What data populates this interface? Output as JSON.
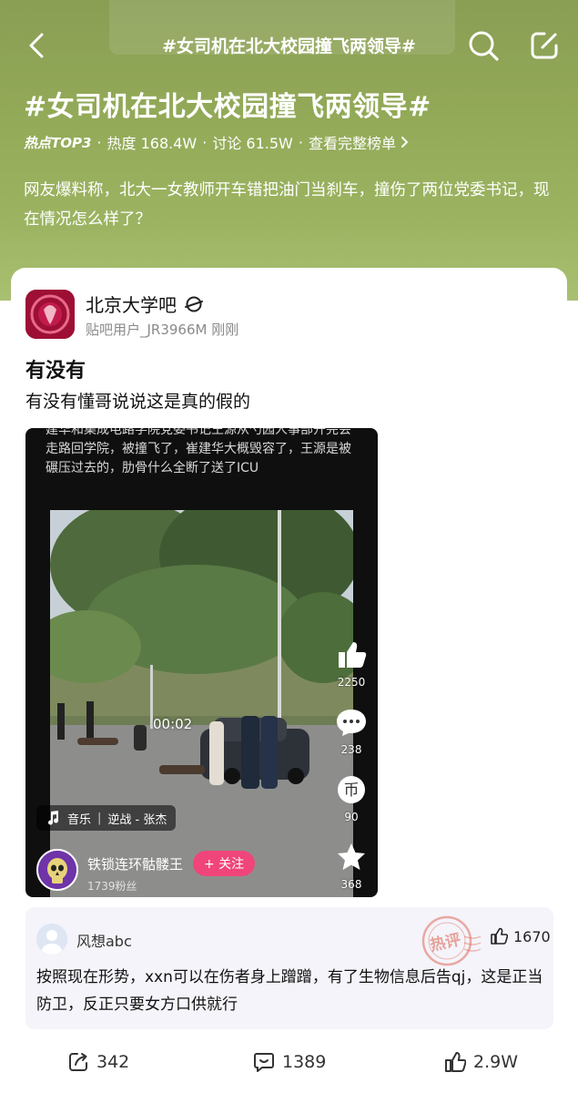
{
  "topbar": {
    "title": "#女司机在北大校园撞飞两领导#"
  },
  "hero": {
    "title": "#女司机在北大校园撞飞两领导#",
    "rank_badge": "热点TOP3",
    "heat": "热度 168.4W",
    "discussion": "讨论 61.5W",
    "full_list_link": "查看完整榜单",
    "description": "网友爆料称，北大一女教师开车错把油门当刹车，撞伤了两位党委书记，现在情况怎么样了？"
  },
  "post": {
    "forum_name": "北京大学吧",
    "author_line": "贴吧用户_JR3966M 刚刚",
    "title": "有没有",
    "body": "有没有懂哥说说这是真的假的"
  },
  "video": {
    "overlay_text": "建华和集成电路学院党委书记王源从勺园人事部开完会走路回学院，被撞飞了，崔建华大概毁容了，王源是被碾压过去的，肋骨什么全断了送了ICU",
    "timecode": "00:02",
    "likes": "2250",
    "comments": "238",
    "coins": "90",
    "favorites": "368",
    "music_label": "音乐",
    "music_track": "逆战 - 张杰",
    "author_name": "铁锁连环骷髅王",
    "follow_label": "+ 关注",
    "author_fans": "1739粉丝"
  },
  "hot_comment": {
    "username": "风想abc",
    "stamp_text": "热评",
    "likes": "1670",
    "text": "按照现在形势，xxn可以在伤者身上蹭蹭，有了生物信息后告qj，这是正当防卫，反正只要女方口供就行"
  },
  "bottom": {
    "shares": "342",
    "comments": "1389",
    "likes": "2.9W"
  },
  "colors": {
    "hero_green": "#93aa58",
    "follow_pink": "#f0457a",
    "comment_bg": "#f4f4fa",
    "stamp_red": "#e06a5a"
  }
}
